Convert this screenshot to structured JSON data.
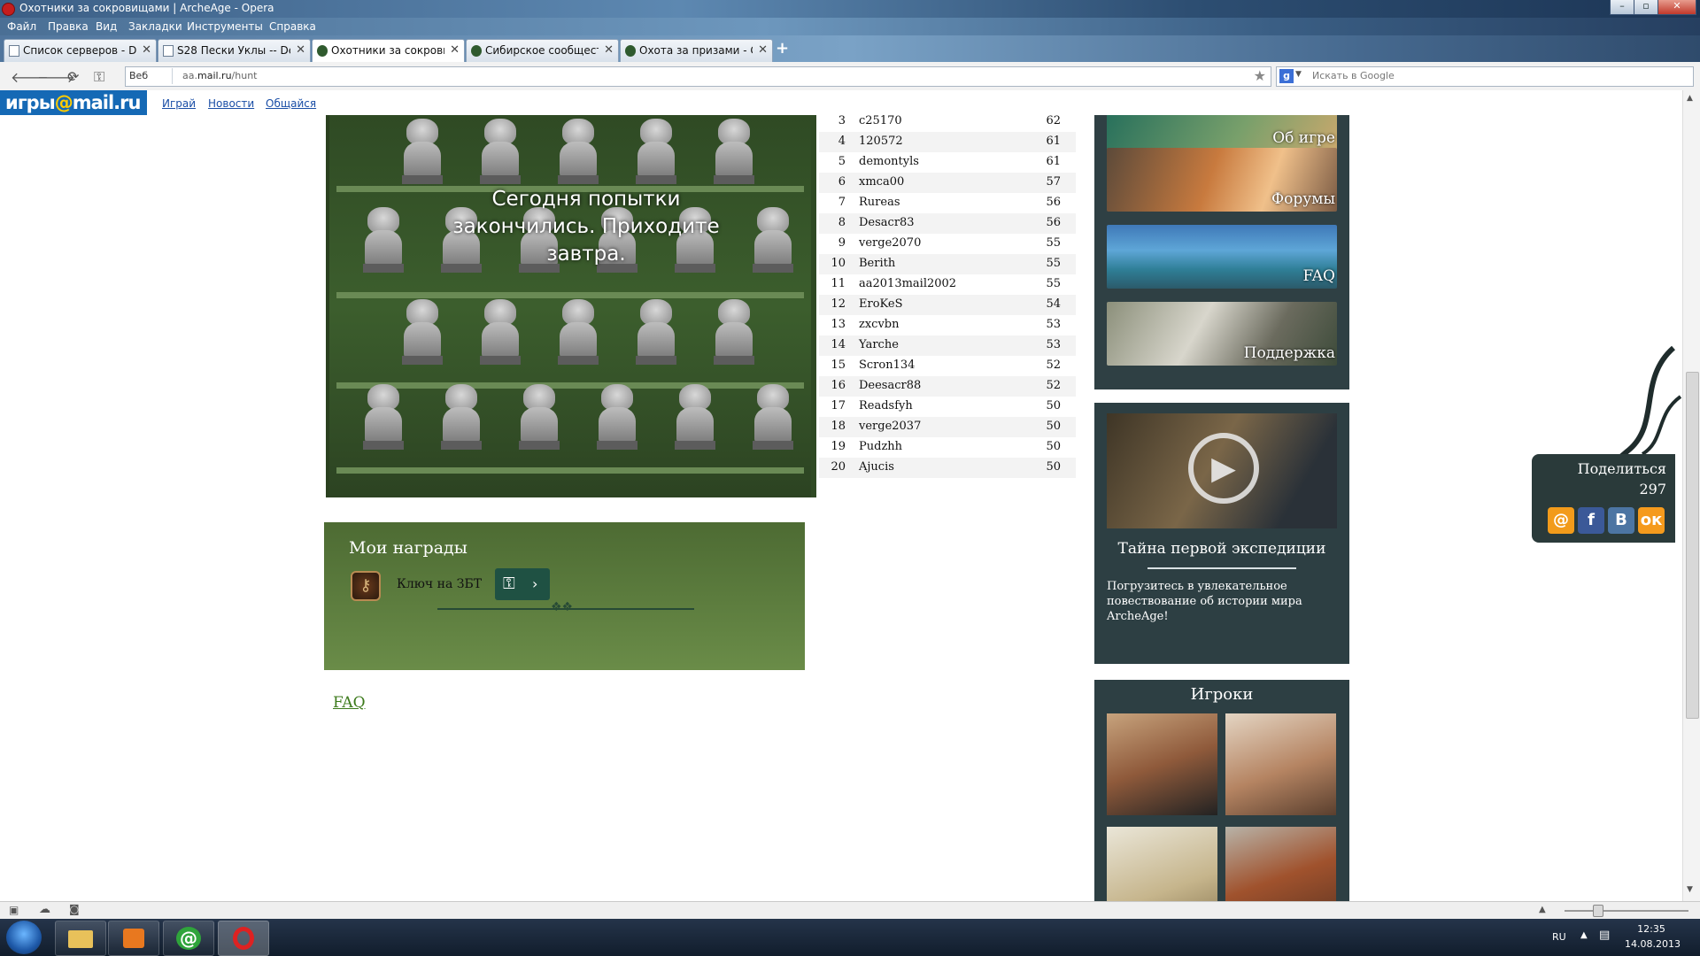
{
  "window": {
    "title": "Охотники за сокровищами | ArcheAge - Opera"
  },
  "menu": [
    "Файл",
    "Правка",
    "Вид",
    "Закладки",
    "Инструменты",
    "Справка"
  ],
  "tabs": [
    {
      "label": "Список серверов - De..."
    },
    {
      "label": "S28 Пески Уклы -- De..."
    },
    {
      "label": "Охотники за сокрови..."
    },
    {
      "label": "Сибирское сообщест..."
    },
    {
      "label": "Охота за призами - Ст..."
    }
  ],
  "address": {
    "web_label": "Веб",
    "url_prefix": "aa.",
    "url_domain": "mail.ru",
    "url_path": "/hunt",
    "search_placeholder": "Искать в Google"
  },
  "portal": {
    "logo_text": "игры",
    "logo_at": "@",
    "logo_mail": "mail",
    "logo_ru": ".ru",
    "links": [
      "Играй",
      "Новости",
      "Общайся"
    ]
  },
  "game": {
    "message": "Сегодня попытки закончились. Приходите завтра."
  },
  "rewards": {
    "title": "Мои награды",
    "item_label": "Ключ на ЗБТ"
  },
  "faq_link": "FAQ",
  "rating": [
    {
      "rank": "3",
      "name": "c25170",
      "score": "62"
    },
    {
      "rank": "4",
      "name": "120572",
      "score": "61"
    },
    {
      "rank": "5",
      "name": "demontyls",
      "score": "61"
    },
    {
      "rank": "6",
      "name": "xmca00",
      "score": "57"
    },
    {
      "rank": "7",
      "name": "Rureas",
      "score": "56"
    },
    {
      "rank": "8",
      "name": "Desacr83",
      "score": "56"
    },
    {
      "rank": "9",
      "name": "verge2070",
      "score": "55"
    },
    {
      "rank": "10",
      "name": "Berith",
      "score": "55"
    },
    {
      "rank": "11",
      "name": "aa2013mail2002",
      "score": "55"
    },
    {
      "rank": "12",
      "name": "EroKeS",
      "score": "54"
    },
    {
      "rank": "13",
      "name": "zxcvbn",
      "score": "53"
    },
    {
      "rank": "14",
      "name": "Yarche",
      "score": "53"
    },
    {
      "rank": "15",
      "name": "Scron134",
      "score": "52"
    },
    {
      "rank": "16",
      "name": "Deesacr88",
      "score": "52"
    },
    {
      "rank": "17",
      "name": "Readsfyh",
      "score": "50"
    },
    {
      "rank": "18",
      "name": "verge2037",
      "score": "50"
    },
    {
      "rank": "19",
      "name": "Pudzhh",
      "score": "50"
    },
    {
      "rank": "20",
      "name": "Ajucis",
      "score": "50"
    }
  ],
  "sidebar": {
    "items": [
      "Об игре",
      "Форумы",
      "FAQ",
      "Поддержка"
    ],
    "video": {
      "title": "Тайна первой экспедиции",
      "description": "Погрузитесь в увлекательное повествование об истории мира ArcheAge!"
    },
    "players_title": "Игроки"
  },
  "share": {
    "label": "Поделиться",
    "count": "297"
  },
  "tray": {
    "lang": "RU",
    "time": "12:35",
    "date": "14.08.2013"
  }
}
